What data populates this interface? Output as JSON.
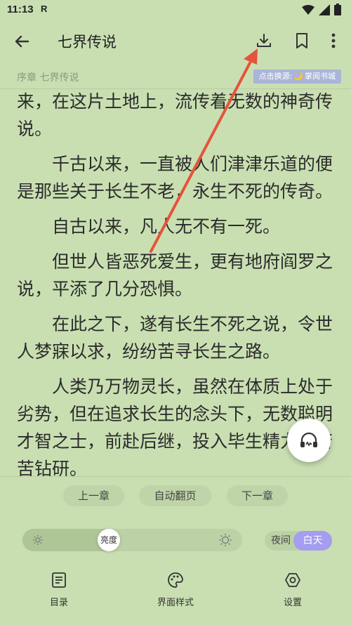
{
  "status_bar": {
    "time": "11:13",
    "r_indicator": "R",
    "icons": [
      "wifi-icon",
      "signal-icon",
      "battery-icon"
    ]
  },
  "topbar": {
    "title": "七界传说",
    "icons": [
      "back-arrow-icon",
      "download-icon",
      "bookmark-icon",
      "more-vert-icon"
    ]
  },
  "chapter": {
    "title": "序章 七界传说",
    "source_prefix": "点击换源:",
    "source_icon": "moon-icon",
    "source_name": "掌阅书城"
  },
  "content": {
    "paragraphs": [
      {
        "text": "来，在这片土地上，流传着无数的神奇传说。",
        "continued": true
      },
      {
        "text": "千古以来，一直被人们津津乐道的便是那些关于长生不老，永生不死的传奇。",
        "continued": false
      },
      {
        "text": "自古以来，凡人无不有一死。",
        "continued": false
      },
      {
        "text": "但世人皆恶死爱生，更有地府阎罗之说，平添了几分恐惧。",
        "continued": false
      },
      {
        "text": "在此之下，遂有长生不死之说，令世人梦寐以求，纷纷苦寻长生之路。",
        "continued": false
      },
      {
        "text": "人类乃万物灵长，虽然在体质上处于劣势，但在追求长生的念头下，无数聪明才智之士，前赴后继，投入毕生精力，苦苦钻研。",
        "continued": false
      }
    ]
  },
  "audio_fab": {
    "icon": "headphones-icon"
  },
  "controls": {
    "prev_chapter": "上一章",
    "auto_page": "自动翻页",
    "next_chapter": "下一章",
    "brightness_label": "亮度",
    "brightness_level": 0.38,
    "night_label": "夜间",
    "day_label": "白天",
    "colors": {
      "day_active": "#a59df0",
      "background": "#c9dfb2"
    }
  },
  "bottom_nav": {
    "toc_label": "目录",
    "style_label": "界面样式",
    "settings_label": "设置",
    "icons": [
      "toc-icon",
      "palette-icon",
      "settings-icon"
    ]
  },
  "annotation": {
    "color": "#e5533b",
    "target": "download-icon"
  }
}
